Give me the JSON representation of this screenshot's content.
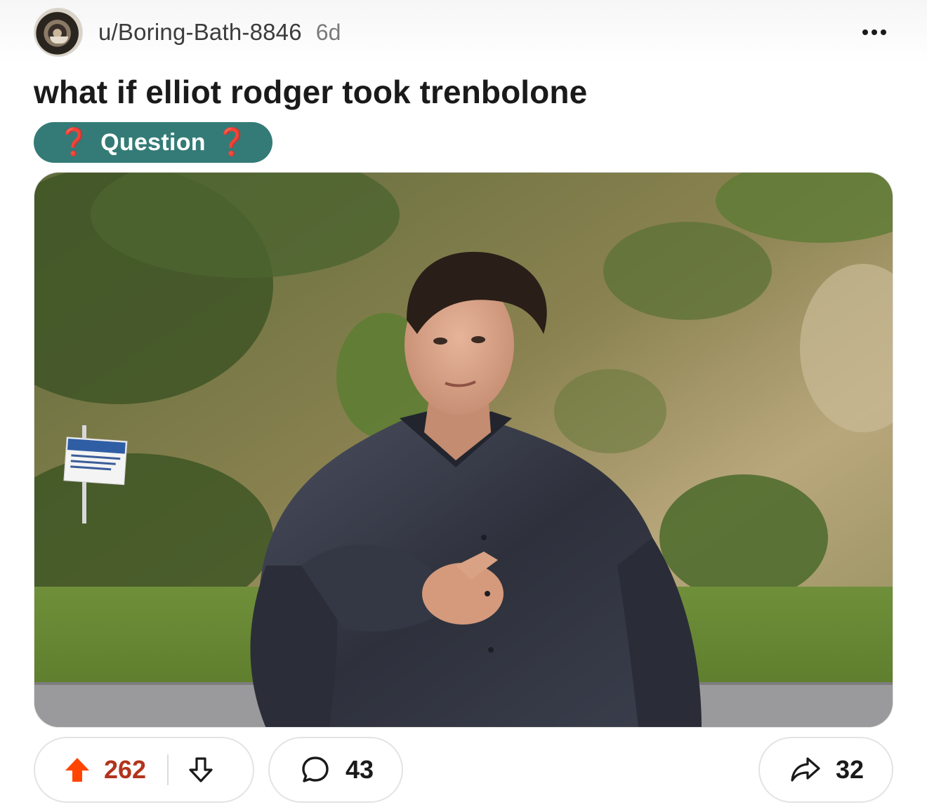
{
  "post": {
    "author": "u/Boring-Bath-8846",
    "age": "6d",
    "title": "what if elliot rodger took trenbolone",
    "flair": {
      "label": "Question",
      "icon_left": "❓",
      "icon_right": "❓",
      "color": "#347b77"
    },
    "image_alt": "muscular man in dark shirt pointing at camera in front of a grassy hillside"
  },
  "actions": {
    "upvotes": "262",
    "comments": "43",
    "shares": "32"
  },
  "colors": {
    "upvote_accent": "#ff4500",
    "vote_count_text": "#b2341c"
  },
  "icons": {
    "more": "more-horizontal-icon",
    "upvote": "upvote-arrow-icon",
    "downvote": "downvote-arrow-icon",
    "comment": "comment-bubble-icon",
    "share": "share-arrow-icon"
  }
}
